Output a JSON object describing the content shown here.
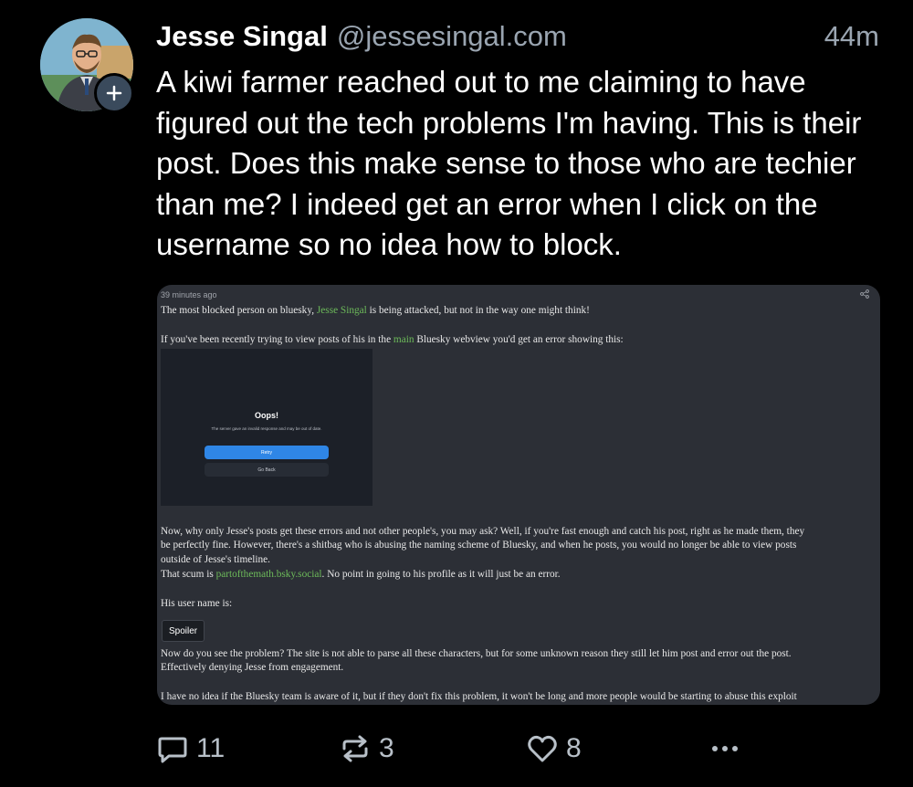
{
  "post": {
    "author_name": "Jesse Singal",
    "author_handle": "@jessesingal.com",
    "timestamp": "44m",
    "text": "A kiwi farmer reached out to me claiming to have figured out the tech problems I'm having. This is their post. Does this make sense to those who are techier than me? I indeed get an error when I click on the username so no idea how to block.",
    "follow_icon": "plus-icon"
  },
  "embed": {
    "meta": "39 minutes ago",
    "share_icon": "share-icon",
    "p1_before": "The most blocked person on bluesky, ",
    "p1_link": "Jesse Singal",
    "p1_after": " is being attacked, but not in the way one might think!",
    "p2_before": "If you've been recently trying to view posts of his in the ",
    "p2_link": "main",
    "p2_after": " Bluesky webview you'd get an error showing this:",
    "oops": {
      "title": "Oops!",
      "message": "The server gave an invalid response and may be out of date.",
      "retry_label": "Retry",
      "goback_label": "Go Back"
    },
    "p3_line1": "Now, why only Jesse's posts get these errors and not other people's, you may ask? Well, if you're fast enough and catch his post, right as he made them, they",
    "p3_line2": "be perfectly fine. However, there's a shitbag who is abusing the naming scheme of Bluesky, and when he posts, you would no longer be able to view posts",
    "p3_line3": "outside of Jesse's timeline.",
    "p4_before": "That scum is ",
    "p4_link": "partofthemath.bsky.social",
    "p4_after": ". No point in going to his profile as it will just be an error.",
    "p5": "His user name is:",
    "spoiler_label": "Spoiler",
    "p6_line1": "Now do you see the problem? The site is not able to parse all these characters, but for some unknown reason they still let him post and error out the post.",
    "p6_line2": "Effectively denying Jesse from engagement.",
    "p7": "I have no idea if the Bluesky team is aware of it, but if they don't fix this problem, it won't be long and more people would be starting to abuse this exploit"
  },
  "actions": {
    "reply_count": "11",
    "repost_count": "3",
    "like_count": "8",
    "reply_icon": "reply-icon",
    "repost_icon": "repost-icon",
    "like_icon": "heart-icon",
    "more_icon": "more-icon"
  },
  "colors": {
    "background": "#000000",
    "muted_text": "#9aa5b1",
    "link_green": "#6dbb5a",
    "embed_bg": "#2c2f36",
    "retry_blue": "#2f86e6"
  }
}
